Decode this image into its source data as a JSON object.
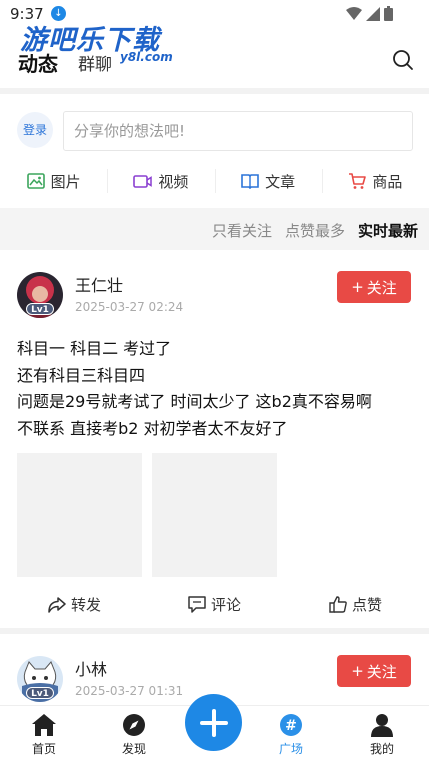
{
  "status_bar": {
    "time": "9:37"
  },
  "watermark": {
    "main": "游吧乐下载",
    "sub": "y8l.com"
  },
  "header": {
    "tab_active": "动态",
    "tab_other": "群聊"
  },
  "compose": {
    "login_label": "登录",
    "placeholder": "分享你的想法吧!"
  },
  "media": [
    {
      "label": "图片",
      "icon": "image-icon",
      "color": "#3ba55c"
    },
    {
      "label": "视频",
      "icon": "video-icon",
      "color": "#8a3fd1"
    },
    {
      "label": "文章",
      "icon": "book-icon",
      "color": "#2b74d8"
    },
    {
      "label": "商品",
      "icon": "cart-icon",
      "color": "#e84a45"
    }
  ],
  "filters": {
    "f1": "只看关注",
    "f2": "点赞最多",
    "f3": "实时最新"
  },
  "posts": [
    {
      "username": "王仁壮",
      "time": "2025-03-27 02:24",
      "level": "Lv1",
      "follow_label": "关注",
      "lines": [
        "科目一 科目二 考过了",
        "还有科目三科目四",
        "问题是29号就考试了 时间太少了 这b2真不容易啊",
        "不联系 直接考b2 对初学者太不友好了"
      ]
    },
    {
      "username": "小林",
      "time": "2025-03-27 01:31",
      "level": "Lv1",
      "follow_label": "关注"
    }
  ],
  "actions": {
    "share": "转发",
    "comment": "评论",
    "like": "点赞"
  },
  "nav": {
    "home": "首页",
    "discover": "发现",
    "plaza": "广场",
    "mine": "我的"
  },
  "colors": {
    "accent": "#1e88e5",
    "follow": "#e84a45"
  }
}
